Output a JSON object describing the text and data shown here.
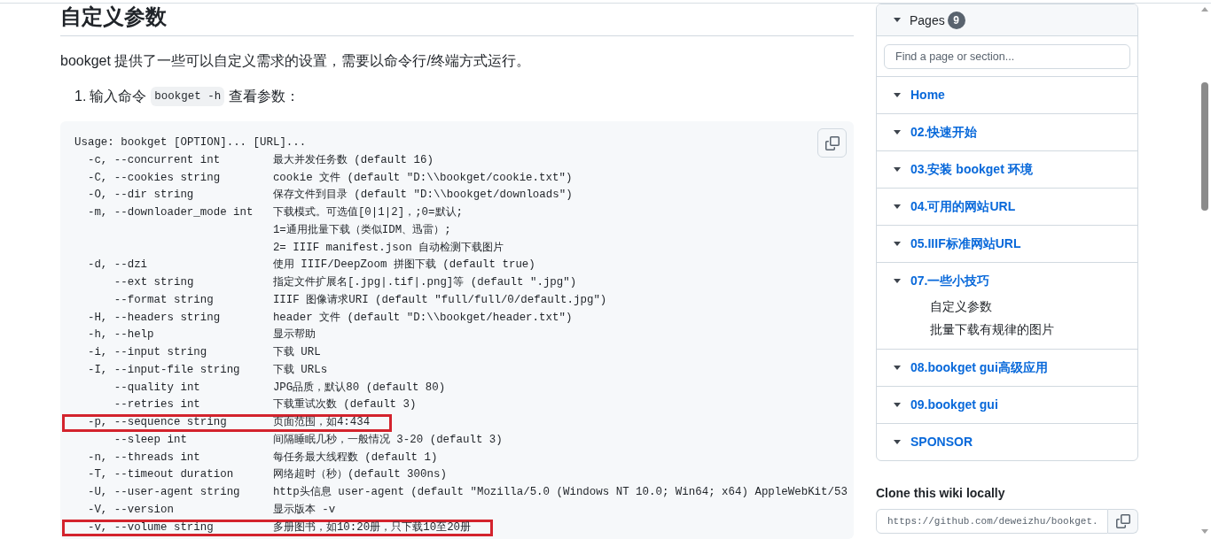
{
  "article": {
    "heading": "自定义参数",
    "intro": "bookget 提供了一些可以自定义需求的设置，需要以命令行/终端方式运行。",
    "steps": [
      {
        "number": "1.",
        "text_before": "输入命令",
        "code": "bookget -h",
        "text_after": "查看参数："
      }
    ],
    "code_block": {
      "usage": "Usage: bookget [OPTION]... [URL]...",
      "lines": [
        {
          "short": "-c,",
          "long": "--concurrent int",
          "description": "最大并发任务数 (default 16)",
          "highlighted": false
        },
        {
          "short": "-C,",
          "long": "--cookies string",
          "description": "cookie 文件 (default \"D:\\\\bookget/cookie.txt\")",
          "highlighted": false
        },
        {
          "short": "-O,",
          "long": "--dir string",
          "description": "保存文件到目录 (default \"D:\\\\bookget/downloads\")",
          "highlighted": false
        },
        {
          "short": "-m,",
          "long": "--downloader_mode int",
          "description": "下载模式。可选值[0|1|2]，;0=默认;",
          "highlighted": false
        },
        {
          "description": "1=通用批量下载（类似IDM、迅雷）;",
          "highlighted": false
        },
        {
          "description": "2= IIIF manifest.json 自动检测下载图片",
          "highlighted": false
        },
        {
          "short": "-d,",
          "long": "--dzi",
          "description": "使用 IIIF/DeepZoom 拼图下载 (default true)",
          "highlighted": false
        },
        {
          "long": "--ext string",
          "description": "指定文件扩展名[.jpg|.tif|.png]等 (default \".jpg\")",
          "highlighted": false
        },
        {
          "long": "--format string",
          "description": "IIIF 图像请求URI (default \"full/full/0/default.jpg\")",
          "highlighted": false
        },
        {
          "short": "-H,",
          "long": "--headers string",
          "description": "header 文件 (default \"D:\\\\bookget/header.txt\")",
          "highlighted": false
        },
        {
          "short": "-h,",
          "long": "--help",
          "description": "显示帮助",
          "highlighted": false
        },
        {
          "short": "-i,",
          "long": "--input string",
          "description": "下载 URL",
          "highlighted": false
        },
        {
          "short": "-I,",
          "long": "--input-file string",
          "description": "下载 URLs",
          "highlighted": false
        },
        {
          "long": "--quality int",
          "description": "JPG品质，默认80 (default 80)",
          "highlighted": false
        },
        {
          "long": "--retries int",
          "description": "下载重试次数 (default 3)",
          "highlighted": false
        },
        {
          "short": "-p,",
          "long": "--sequence string",
          "description": "页面范围，如4:434",
          "highlighted": true
        },
        {
          "long": "--sleep int",
          "description": "间隔睡眠几秒，一般情况 3-20 (default 3)",
          "highlighted": false
        },
        {
          "short": "-n,",
          "long": "--threads int",
          "description": "每任务最大线程数 (default 1)",
          "highlighted": false
        },
        {
          "short": "-T,",
          "long": "--timeout duration",
          "description": "网络超时（秒）(default 300ns)",
          "highlighted": false
        },
        {
          "short": "-U,",
          "long": "--user-agent string",
          "description": "http头信息 user-agent (default \"Mozilla/5.0 (Windows NT 10.0; Win64; x64) AppleWebKit/53",
          "highlighted": false
        },
        {
          "short": "-V,",
          "long": "--version",
          "description": "显示版本 -v",
          "highlighted": false
        },
        {
          "short": "-v,",
          "long": "--volume string",
          "description": "多册图书，如10:20册，只下载10至20册",
          "highlighted": true
        }
      ]
    }
  },
  "sidebar": {
    "title": "Pages",
    "count": "9",
    "search": {
      "placeholder": "Find a page or section..."
    },
    "pages": [
      {
        "label": "Home"
      },
      {
        "label": "02.快速开始"
      },
      {
        "label": "03.安装 bookget 环境"
      },
      {
        "label": "04.可用的网站URL"
      },
      {
        "label": "05.IIIF标准网站URL"
      },
      {
        "label": "07.一些小技巧",
        "children": [
          {
            "label": "自定义参数"
          },
          {
            "label": "批量下载有规律的图片"
          }
        ]
      },
      {
        "label": "08.bookget gui高级应用"
      },
      {
        "label": "09.bookget gui"
      },
      {
        "label": "SPONSOR"
      }
    ],
    "clone": {
      "title": "Clone this wiki locally",
      "url": "https://github.com/deweizhu/bookget."
    }
  }
}
